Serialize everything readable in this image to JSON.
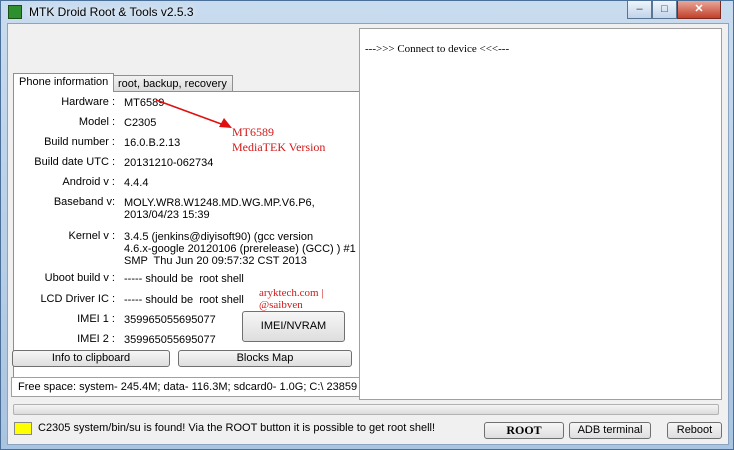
{
  "window": {
    "title": "MTK Droid Root & Tools v2.5.3",
    "controls": {
      "minimize": "–",
      "maximize": "□",
      "close": "✕"
    }
  },
  "tabs": [
    {
      "label": "Phone information",
      "active": true
    },
    {
      "label": "root, backup, recovery",
      "active": false
    }
  ],
  "phone_info": {
    "hardware": {
      "label": "Hardware :",
      "value": "MT6589"
    },
    "model": {
      "label": "Model :",
      "value": "C2305"
    },
    "build_number": {
      "label": "Build number :",
      "value": "16.0.B.2.13"
    },
    "build_date": {
      "label": "Build date UTC :",
      "value": "20131210-062734"
    },
    "android": {
      "label": "Android  v :",
      "value": "4.4.4"
    },
    "baseband": {
      "label": "Baseband v:",
      "value": "MOLY.WR8.W1248.MD.WG.MP.V6.P6,\n2013/04/23 15:39"
    },
    "kernel": {
      "label": "Kernel v :",
      "value": "3.4.5 (jenkins@diyisoft90) (gcc version\n4.6.x-google 20120106 (prerelease) (GCC) ) #1\nSMP  Thu Jun 20 09:57:32 CST 2013"
    },
    "uboot": {
      "label": "Uboot build v :",
      "value": "----- should be  root shell"
    },
    "lcd": {
      "label": "LCD Driver IC :",
      "value": "----- should be  root shell"
    },
    "imei1": {
      "label": "IMEI 1 :",
      "value": "359965055695077"
    },
    "imei2": {
      "label": "IMEI 2 :",
      "value": "359965055695077"
    }
  },
  "annotations": {
    "chip": "MT6589",
    "vendor": "MediaTEK Version",
    "watermark": "aryktech.com | @saibven"
  },
  "buttons": {
    "imei_nvram": "IMEI/NVRAM",
    "info_clipboard": "Info to clipboard",
    "blocks_map": "Blocks Map",
    "root": "ROOT",
    "adb_terminal": "ADB terminal",
    "reboot": "Reboot"
  },
  "log": {
    "text": "--->>> Connect to device <<<---"
  },
  "free_space": "Free space: system- 245.4M; data- 116.3M; sdcard0- 1.0G;  C:\\ 23859",
  "progress": {
    "value": 0
  },
  "status": {
    "indicator_color": "#ffff00",
    "message": "C2305 system/bin/su is found! Via the ROOT button it is possible to get root shell!"
  },
  "colors": {
    "annotation": "#d11a1a",
    "arrow": "#e01010"
  }
}
